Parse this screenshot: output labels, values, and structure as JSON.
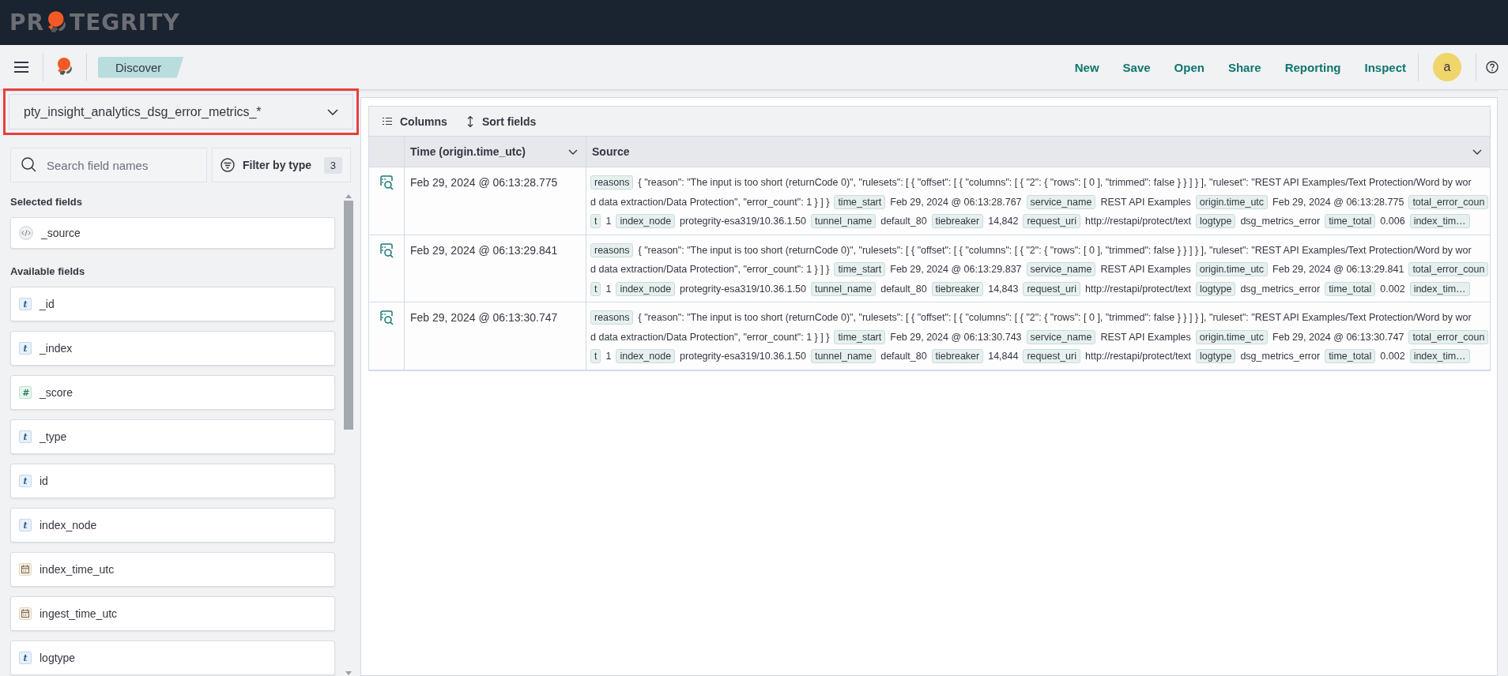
{
  "brand": {
    "parts": [
      "PR",
      "TEGRITY"
    ]
  },
  "nav": {
    "breadcrumb": "Discover",
    "links": [
      "New",
      "Save",
      "Open",
      "Share",
      "Reporting",
      "Inspect"
    ],
    "avatar": "a"
  },
  "sidebar": {
    "index_pattern": "pty_insight_analytics_dsg_error_metrics_*",
    "search": {
      "placeholder": "Search field names"
    },
    "filter": {
      "label": "Filter by type",
      "count": "3"
    },
    "sections": [
      {
        "title": "Selected fields",
        "fields": [
          {
            "name": "_source",
            "kind": "source"
          }
        ]
      },
      {
        "title": "Available fields",
        "fields": [
          {
            "name": "_id",
            "kind": "string",
            "badge": "t"
          },
          {
            "name": "_index",
            "kind": "string",
            "badge": "t"
          },
          {
            "name": "_score",
            "kind": "number",
            "badge": "#"
          },
          {
            "name": "_type",
            "kind": "string",
            "badge": "t"
          },
          {
            "name": "id",
            "kind": "string",
            "badge": "t"
          },
          {
            "name": "index_node",
            "kind": "string",
            "badge": "t"
          },
          {
            "name": "index_time_utc",
            "kind": "date"
          },
          {
            "name": "ingest_time_utc",
            "kind": "date"
          },
          {
            "name": "logtype",
            "kind": "string",
            "badge": "t"
          }
        ]
      }
    ]
  },
  "table": {
    "toolbar": [
      "Columns",
      "Sort fields"
    ],
    "columns": [
      "Time (origin.time_utc)",
      "Source"
    ],
    "rows": [
      {
        "time": "Feb 29, 2024 @ 06:13:28.775",
        "source": [
          [
            {
              "kind": "key",
              "text": "reasons"
            },
            {
              "kind": "value",
              "text": "{ \"reason\": \"The input is too short (returnCode 0)\", \"rulesets\": [ { \"offset\": [ { \"columns\": [ { \"2\": { \"rows\": [ 0 ], \"trimmed\": false } } ] } ], \"ruleset\": \"REST API Examples/Text Protection/Word by wor"
            }
          ],
          [
            {
              "kind": "value",
              "text": "d data extraction/Data Protection\", \"error_count\": 1 } ] }"
            },
            {
              "kind": "key",
              "text": "time_start"
            },
            {
              "kind": "value",
              "text": "Feb 29, 2024 @ 06:13:28.767"
            },
            {
              "kind": "key",
              "text": "service_name"
            },
            {
              "kind": "value",
              "text": "REST API Examples"
            },
            {
              "kind": "key",
              "text": "origin.time_utc"
            },
            {
              "kind": "value",
              "text": "Feb 29, 2024 @ 06:13:28.775"
            },
            {
              "kind": "key",
              "text": "total_error_coun"
            }
          ],
          [
            {
              "kind": "key",
              "text": "t"
            },
            {
              "kind": "value",
              "text": "1"
            },
            {
              "kind": "key",
              "text": "index_node"
            },
            {
              "kind": "value",
              "text": "protegrity-esa319/10.36.1.50"
            },
            {
              "kind": "key",
              "text": "tunnel_name"
            },
            {
              "kind": "value",
              "text": "default_80"
            },
            {
              "kind": "key",
              "text": "tiebreaker"
            },
            {
              "kind": "value",
              "text": "14,842"
            },
            {
              "kind": "key",
              "text": "request_uri"
            },
            {
              "kind": "value",
              "text": "http://restapi/protect/text"
            },
            {
              "kind": "key",
              "text": "logtype"
            },
            {
              "kind": "value",
              "text": "dsg_metrics_error"
            },
            {
              "kind": "key",
              "text": "time_total"
            },
            {
              "kind": "value",
              "text": "0.006"
            },
            {
              "kind": "key",
              "text": "index_tim…"
            }
          ]
        ]
      },
      {
        "time": "Feb 29, 2024 @ 06:13:29.841",
        "source": [
          [
            {
              "kind": "key",
              "text": "reasons"
            },
            {
              "kind": "value",
              "text": "{ \"reason\": \"The input is too short (returnCode 0)\", \"rulesets\": [ { \"offset\": [ { \"columns\": [ { \"2\": { \"rows\": [ 0 ], \"trimmed\": false } } ] } ], \"ruleset\": \"REST API Examples/Text Protection/Word by wor"
            }
          ],
          [
            {
              "kind": "value",
              "text": "d data extraction/Data Protection\", \"error_count\": 1 } ] }"
            },
            {
              "kind": "key",
              "text": "time_start"
            },
            {
              "kind": "value",
              "text": "Feb 29, 2024 @ 06:13:29.837"
            },
            {
              "kind": "key",
              "text": "service_name"
            },
            {
              "kind": "value",
              "text": "REST API Examples"
            },
            {
              "kind": "key",
              "text": "origin.time_utc"
            },
            {
              "kind": "value",
              "text": "Feb 29, 2024 @ 06:13:29.841"
            },
            {
              "kind": "key",
              "text": "total_error_coun"
            }
          ],
          [
            {
              "kind": "key",
              "text": "t"
            },
            {
              "kind": "value",
              "text": "1"
            },
            {
              "kind": "key",
              "text": "index_node"
            },
            {
              "kind": "value",
              "text": "protegrity-esa319/10.36.1.50"
            },
            {
              "kind": "key",
              "text": "tunnel_name"
            },
            {
              "kind": "value",
              "text": "default_80"
            },
            {
              "kind": "key",
              "text": "tiebreaker"
            },
            {
              "kind": "value",
              "text": "14,843"
            },
            {
              "kind": "key",
              "text": "request_uri"
            },
            {
              "kind": "value",
              "text": "http://restapi/protect/text"
            },
            {
              "kind": "key",
              "text": "logtype"
            },
            {
              "kind": "value",
              "text": "dsg_metrics_error"
            },
            {
              "kind": "key",
              "text": "time_total"
            },
            {
              "kind": "value",
              "text": "0.002"
            },
            {
              "kind": "key",
              "text": "index_tim…"
            }
          ]
        ]
      },
      {
        "time": "Feb 29, 2024 @ 06:13:30.747",
        "source": [
          [
            {
              "kind": "key",
              "text": "reasons"
            },
            {
              "kind": "value",
              "text": "{ \"reason\": \"The input is too short (returnCode 0)\", \"rulesets\": [ { \"offset\": [ { \"columns\": [ { \"2\": { \"rows\": [ 0 ], \"trimmed\": false } } ] } ], \"ruleset\": \"REST API Examples/Text Protection/Word by wor"
            }
          ],
          [
            {
              "kind": "value",
              "text": "d data extraction/Data Protection\", \"error_count\": 1 } ] }"
            },
            {
              "kind": "key",
              "text": "time_start"
            },
            {
              "kind": "value",
              "text": "Feb 29, 2024 @ 06:13:30.743"
            },
            {
              "kind": "key",
              "text": "service_name"
            },
            {
              "kind": "value",
              "text": "REST API Examples"
            },
            {
              "kind": "key",
              "text": "origin.time_utc"
            },
            {
              "kind": "value",
              "text": "Feb 29, 2024 @ 06:13:30.747"
            },
            {
              "kind": "key",
              "text": "total_error_coun"
            }
          ],
          [
            {
              "kind": "key",
              "text": "t"
            },
            {
              "kind": "value",
              "text": "1"
            },
            {
              "kind": "key",
              "text": "index_node"
            },
            {
              "kind": "value",
              "text": "protegrity-esa319/10.36.1.50"
            },
            {
              "kind": "key",
              "text": "tunnel_name"
            },
            {
              "kind": "value",
              "text": "default_80"
            },
            {
              "kind": "key",
              "text": "tiebreaker"
            },
            {
              "kind": "value",
              "text": "14,844"
            },
            {
              "kind": "key",
              "text": "request_uri"
            },
            {
              "kind": "value",
              "text": "http://restapi/protect/text"
            },
            {
              "kind": "key",
              "text": "logtype"
            },
            {
              "kind": "value",
              "text": "dsg_metrics_error"
            },
            {
              "kind": "key",
              "text": "time_total"
            },
            {
              "kind": "value",
              "text": "0.002"
            },
            {
              "kind": "key",
              "text": "index_tim…"
            }
          ]
        ]
      }
    ]
  }
}
